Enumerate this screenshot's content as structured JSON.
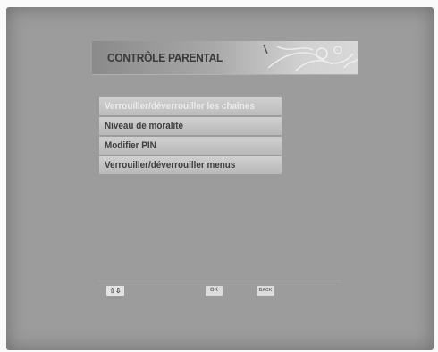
{
  "header": {
    "title": "CONTRÔLE PARENTAL",
    "decoration_icon": "swirl-ornament-icon"
  },
  "menu": {
    "items": [
      {
        "label": "Verrouiller/déverrouiller les chaînes",
        "selected": true
      },
      {
        "label": "Niveau de moralité",
        "selected": false
      },
      {
        "label": "Modifier PIN",
        "selected": false
      },
      {
        "label": "Verrouiller/déverrouiller menus",
        "selected": false
      }
    ]
  },
  "footer": {
    "nav_key": "⇧⇩",
    "nav_icon": "up-down-arrows-icon",
    "ok_key": "OK",
    "back_key": "BACK"
  },
  "colors": {
    "background": "#9c9c9c",
    "header_gradient_end": "#d8d8d8",
    "menu_item": "#c4c4c4",
    "text": "#3e3e3e"
  }
}
